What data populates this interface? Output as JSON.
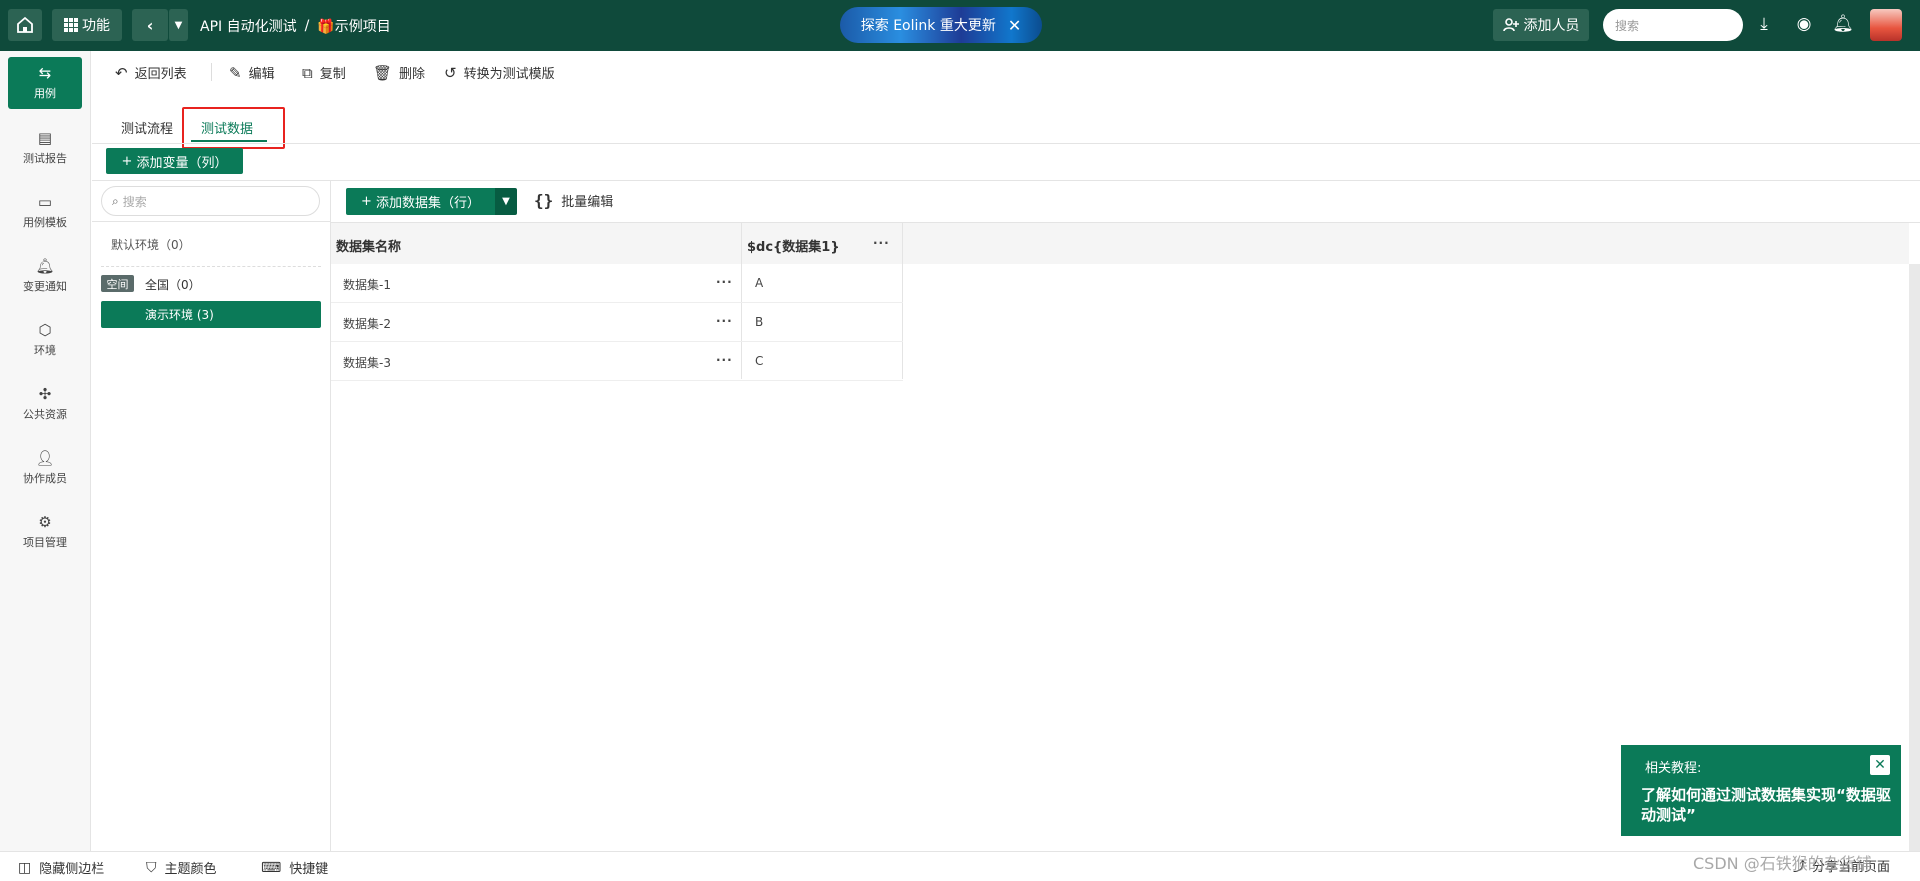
{
  "topbar": {
    "function_label": "功能",
    "breadcrumb_root": "API 自动化测试",
    "breadcrumb_sep": "/",
    "breadcrumb_project": "示例项目",
    "promo_text": "探索 Eolink 重大更新",
    "promo_close": "✕",
    "add_member_label": "添加人员",
    "search_placeholder": "搜索"
  },
  "leftnav": {
    "items": [
      {
        "label": "用例",
        "icon": "swap-icon"
      },
      {
        "label": "测试报告",
        "icon": "report-icon"
      },
      {
        "label": "用例模板",
        "icon": "template-icon"
      },
      {
        "label": "变更通知",
        "icon": "bell-icon"
      },
      {
        "label": "环境",
        "icon": "cube-icon"
      },
      {
        "label": "公共资源",
        "icon": "puzzle-icon"
      },
      {
        "label": "协作成员",
        "icon": "member-icon"
      },
      {
        "label": "项目管理",
        "icon": "settings-icon"
      }
    ]
  },
  "toolbar": {
    "back_label": "返回列表",
    "edit_label": "编辑",
    "copy_label": "复制",
    "delete_label": "删除",
    "convert_label": "转换为测试模版"
  },
  "tabs": [
    "测试流程",
    "测试数据"
  ],
  "add_variable_label": "添加变量（列）",
  "env_panel": {
    "search_placeholder": "搜索",
    "default_env": "默认环境（0）",
    "space_badge": "空间",
    "global_env": "全国（0）",
    "demo_env": "演示环境 (3)"
  },
  "data_area": {
    "add_dataset_label": "添加数据集（行）",
    "batch_edit_label": "批量编辑",
    "columns": [
      "数据集名称",
      "$dc{数据集1}"
    ],
    "rows": [
      {
        "name": "数据集-1",
        "value": "A"
      },
      {
        "name": "数据集-2",
        "value": "B"
      },
      {
        "name": "数据集-3",
        "value": "C"
      }
    ]
  },
  "tutorial": {
    "label": "相关教程:",
    "text": "了解如何通过测试数据集实现“数据驱动测试”"
  },
  "bottombar": {
    "hide_sidebar": "隐藏侧边栏",
    "theme_color": "主题颜色",
    "shortcuts": "快捷键",
    "share_page": "分享当前页面"
  },
  "watermark": "CSDN @石铁猴的杂货铺",
  "colors": {
    "primary": "#0b7a58",
    "topbar": "#0f4a3b",
    "highlight_box": "#e8231f"
  }
}
